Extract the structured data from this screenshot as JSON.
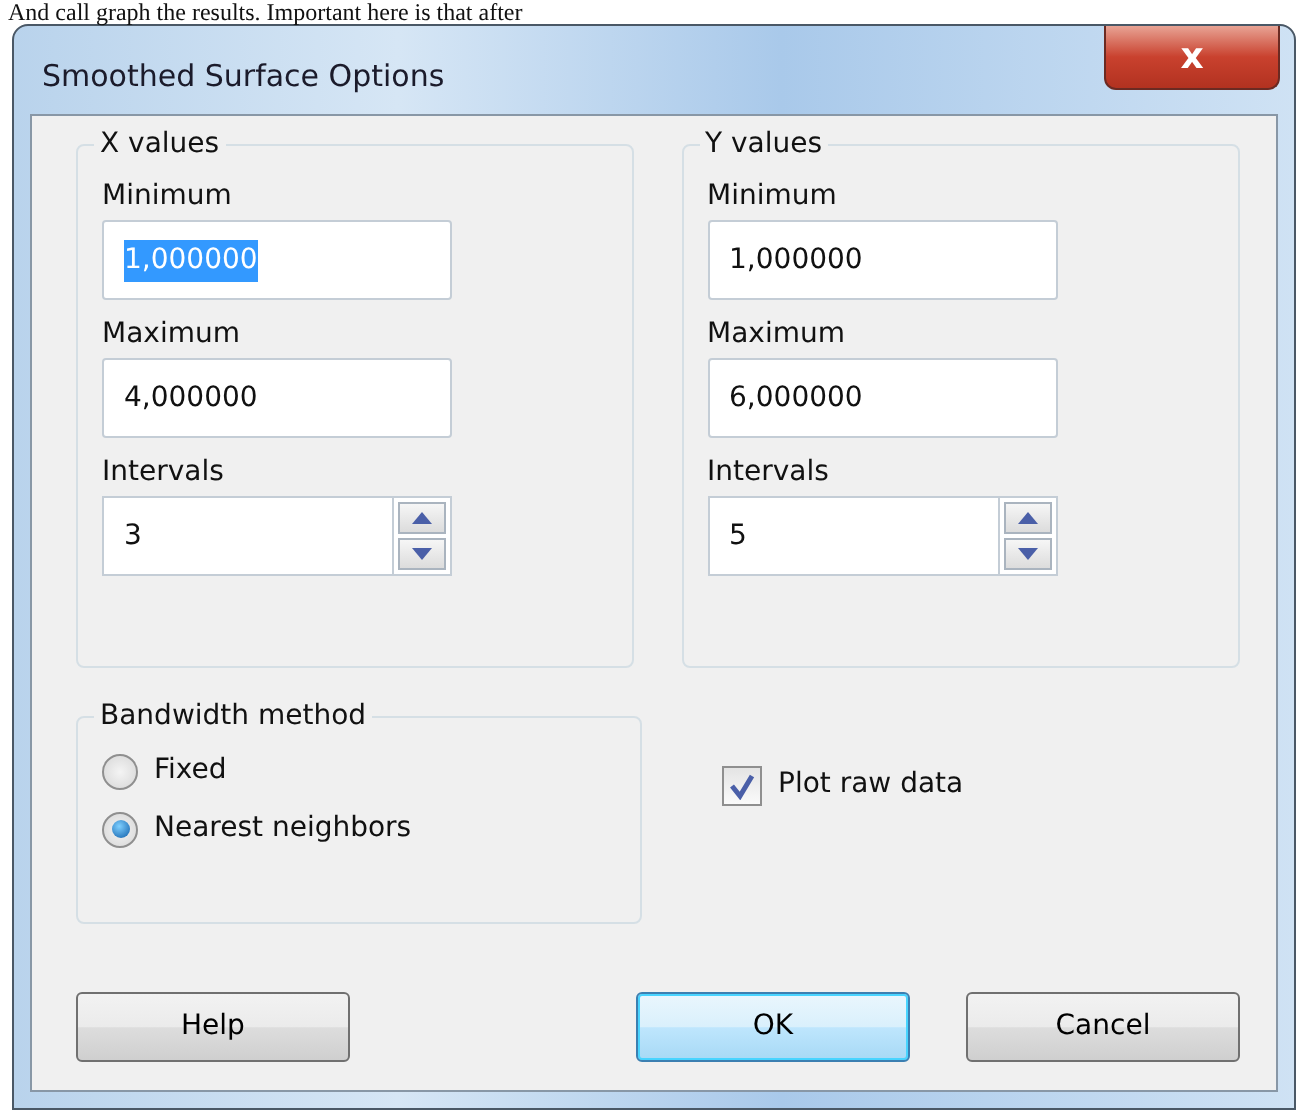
{
  "background_text": "And call graph the results. Important here is that after",
  "window": {
    "title": "Smoothed Surface Options",
    "close_symbol": "x"
  },
  "groups": [
    {
      "title": "X values",
      "fields": [
        {
          "label": "Minimum",
          "value": "1,000000",
          "selected": true,
          "kind": "text"
        },
        {
          "label": "Maximum",
          "value": "4,000000",
          "selected": false,
          "kind": "text"
        },
        {
          "label": "Intervals",
          "value": "3",
          "selected": false,
          "kind": "spin"
        }
      ]
    },
    {
      "title": "Y values",
      "fields": [
        {
          "label": "Minimum",
          "value": "1,000000",
          "selected": false,
          "kind": "text"
        },
        {
          "label": "Maximum",
          "value": "6,000000",
          "selected": false,
          "kind": "text"
        },
        {
          "label": "Intervals",
          "value": "5",
          "selected": false,
          "kind": "spin"
        }
      ]
    }
  ],
  "bandwidth": {
    "title": "Bandwidth method",
    "options": [
      {
        "label": "Fixed",
        "selected": false
      },
      {
        "label": "Nearest neighbors",
        "selected": true
      }
    ]
  },
  "plot_raw_data": {
    "label": "Plot raw data",
    "checked": true
  },
  "buttons": [
    {
      "label": "Help",
      "default": false
    },
    {
      "label": "OK",
      "default": true
    },
    {
      "label": "Cancel",
      "default": false
    }
  ]
}
